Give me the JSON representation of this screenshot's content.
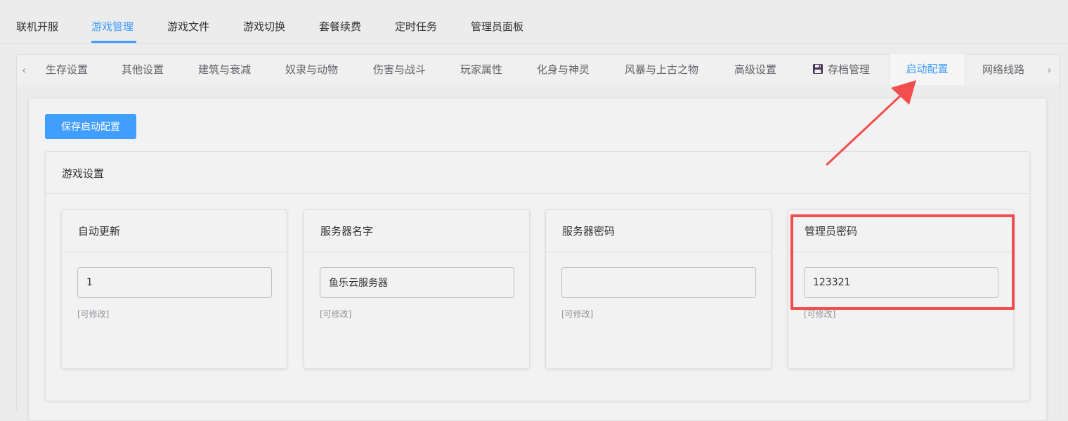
{
  "top_nav": {
    "items": [
      "联机开服",
      "游戏管理",
      "游戏文件",
      "游戏切换",
      "套餐续费",
      "定时任务",
      "管理员面板"
    ],
    "active": "游戏管理"
  },
  "tabs": {
    "items": [
      "生存设置",
      "其他设置",
      "建筑与衰减",
      "奴隶与动物",
      "伤害与战斗",
      "玩家属性",
      "化身与神灵",
      "风暴与上古之物",
      "高级设置",
      "存档管理",
      "启动配置",
      "网络线路"
    ],
    "active": "启动配置",
    "prev_icon": "chevron-left-icon",
    "next_icon": "chevron-right-icon",
    "save_tab_icon": "floppy-disk-icon"
  },
  "toolbar": {
    "save_label": "保存启动配置"
  },
  "settings": {
    "title": "游戏设置",
    "fields": [
      {
        "label": "自动更新",
        "value": "1",
        "hint": "[可修改]"
      },
      {
        "label": "服务器名字",
        "value": "鱼乐云服务器",
        "hint": "[可修改]"
      },
      {
        "label": "服务器密码",
        "value": "",
        "hint": "[可修改]"
      },
      {
        "label": "管理员密码",
        "value": "123321",
        "hint": "[可修改]"
      }
    ]
  },
  "colors": {
    "accent": "#409eff",
    "annotation": "#f24e4e"
  }
}
